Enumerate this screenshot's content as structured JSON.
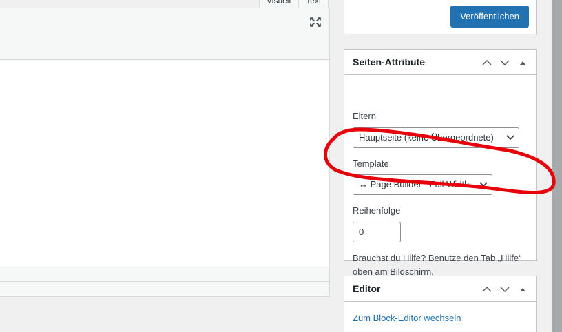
{
  "editor": {
    "tabs": [
      {
        "label": "Visuell"
      },
      {
        "label": "Text"
      }
    ]
  },
  "publish": {
    "button_label": "Veröffentlichen"
  },
  "page_attributes": {
    "title": "Seiten-Attribute",
    "parent_label": "Eltern",
    "parent_value": "Hauptseite (keine Übergeordnete)",
    "template_label": "Template",
    "template_value": "↔ Page Builder - Full Width",
    "order_label": "Reihenfolge",
    "order_value": "0",
    "help_line1": "Brauchst du Hilfe? Benutze den Tab „Hilfe“",
    "help_line2": "oben am Bildschirm."
  },
  "editor_box": {
    "title": "Editor",
    "switch_link": "Zum Block-Editor wechseln"
  },
  "colors": {
    "primary": "#2271b1",
    "annotation": "#e8000b"
  },
  "icons": {
    "fullscreen": "fullscreen-icon",
    "move_up": "chevron-up-icon",
    "move_down": "chevron-down-icon",
    "toggle": "triangle-up-icon"
  }
}
